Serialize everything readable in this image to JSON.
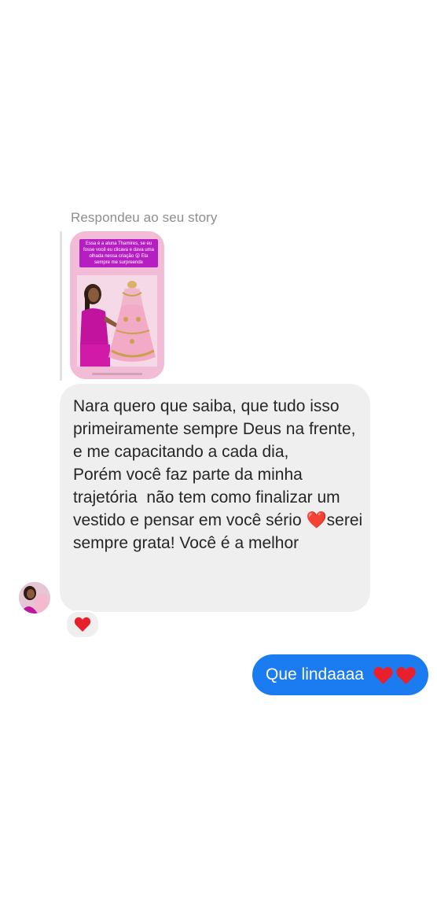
{
  "reply_label": "Respondeu ao seu story",
  "story": {
    "caption": "Essa é a aluna Thamires, se eu fosse você eu clicava e dava uma olhada nessa criação 😮 Ela sempre me surpreende"
  },
  "received_message": {
    "text_before_heart": "Nara quero que saiba, que tudo isso primeiramente sempre Deus na frente, e me capacitando a cada dia,\nPorém você faz parte da minha trajetória  não tem como finalizar um vestido e pensar em você sério ",
    "heart": "❤️",
    "text_after_heart": "serei sempre grata! Você é a melhor"
  },
  "reaction": {
    "icon": "heart-icon",
    "color": "#e8202b"
  },
  "sent_message": {
    "text": "Que lindaaaa"
  },
  "colors": {
    "sent_bubble": "#1b7cf2",
    "received_bubble": "#efefef",
    "heart": "#e8202b"
  }
}
